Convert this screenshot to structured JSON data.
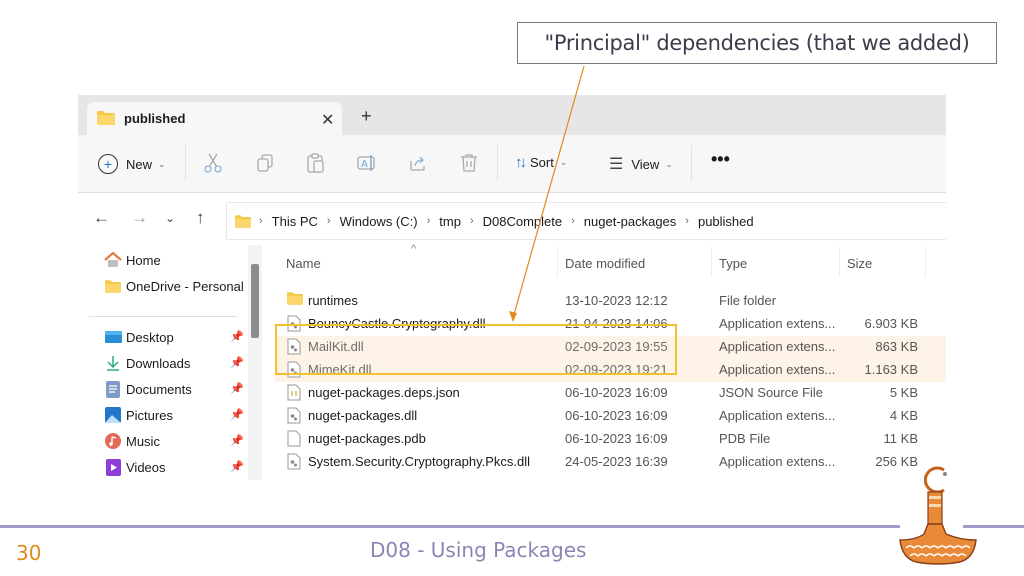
{
  "callout": {
    "text": "\"Principal\" dependencies (that we added)",
    "arrow_color": "#e08a1e"
  },
  "window": {
    "tab": {
      "label": "published",
      "close_icon": "close-icon",
      "new_tab_icon": "plus-icon"
    },
    "toolbar": {
      "new_label": "New",
      "sort_label": "Sort",
      "view_label": "View",
      "more_icon": "ellipsis-icon",
      "actions": [
        "cut",
        "copy",
        "paste",
        "rename",
        "share",
        "delete"
      ]
    },
    "address": {
      "crumbs": [
        "This PC",
        "Windows (C:)",
        "tmp",
        "D08Complete",
        "nuget-packages",
        "published"
      ]
    },
    "nav": {
      "top": [
        {
          "label": "Home",
          "icon": "home-icon"
        },
        {
          "label": "OneDrive - Personal",
          "icon": "cloud-folder-icon"
        }
      ],
      "pinned": [
        {
          "label": "Desktop",
          "icon": "desktop-icon"
        },
        {
          "label": "Downloads",
          "icon": "download-icon"
        },
        {
          "label": "Documents",
          "icon": "documents-icon"
        },
        {
          "label": "Pictures",
          "icon": "pictures-icon"
        },
        {
          "label": "Music",
          "icon": "music-icon"
        },
        {
          "label": "Videos",
          "icon": "videos-icon"
        }
      ]
    },
    "columns": {
      "name": "Name",
      "date": "Date modified",
      "type": "Type",
      "size": "Size"
    },
    "files": [
      {
        "name": "runtimes",
        "date": "13-10-2023 12:12",
        "type": "File folder",
        "size": "",
        "icon": "folder",
        "highlighted": false
      },
      {
        "name": "BouncyCastle.Cryptography.dll",
        "date": "21-04-2023 14:06",
        "type": "Application extens...",
        "size": "6.903 KB",
        "icon": "dll",
        "highlighted": false
      },
      {
        "name": "MailKit.dll",
        "date": "02-09-2023 19:55",
        "type": "Application extens...",
        "size": "863 KB",
        "icon": "dll",
        "highlighted": true
      },
      {
        "name": "MimeKit.dll",
        "date": "02-09-2023 19:21",
        "type": "Application extens...",
        "size": "1.163 KB",
        "icon": "dll",
        "highlighted": true
      },
      {
        "name": "nuget-packages.deps.json",
        "date": "06-10-2023 16:09",
        "type": "JSON Source File",
        "size": "5 KB",
        "icon": "json",
        "highlighted": false
      },
      {
        "name": "nuget-packages.dll",
        "date": "06-10-2023 16:09",
        "type": "Application extens...",
        "size": "4 KB",
        "icon": "dll",
        "highlighted": false
      },
      {
        "name": "nuget-packages.pdb",
        "date": "06-10-2023 16:09",
        "type": "PDB File",
        "size": "11 KB",
        "icon": "file",
        "highlighted": false
      },
      {
        "name": "System.Security.Cryptography.Pkcs.dll",
        "date": "24-05-2023 16:39",
        "type": "Application extens...",
        "size": "256 KB",
        "icon": "dll",
        "highlighted": false
      }
    ],
    "highlight_color": "#f2c12e"
  },
  "footer": {
    "page_number": "30",
    "title": "D08 - Using Packages"
  }
}
